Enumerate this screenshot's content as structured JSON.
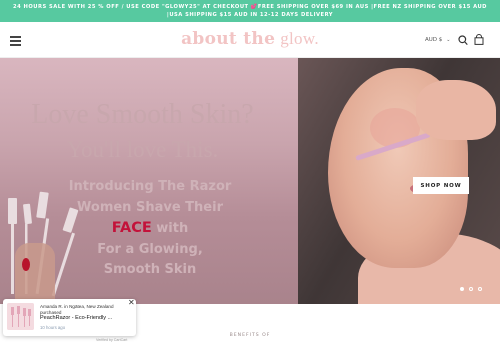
{
  "announcement": {
    "text": "24 HOURS SALE WITH 25 % OFF / USE CODE \"GLOWY25\" AT CHECKOUT 💕FREE SHIPPING OVER $69 IN AUS |FREE NZ SHIPPING OVER $15 AUD |USA SHIPPING $15 AUD IN 12-12 DAYS DELIVERY"
  },
  "header": {
    "logo_bold": "about the",
    "logo_light": "glow.",
    "currency": "AUD $",
    "icons": [
      "menu-icon",
      "search-icon",
      "cart-icon"
    ]
  },
  "hero": {
    "title": "Love Smooth Skin?",
    "subtitle": "You'll love This.",
    "intro_line1": "Introducing The Razor",
    "intro_line2": "Women Shave Their",
    "intro_face": "FACE",
    "intro_with": "with",
    "intro_line4": "For a Glowing,",
    "intro_line5": "Smooth Skin",
    "cta": "SHOP NOW",
    "slide_count": 3,
    "active_slide": 1
  },
  "popup": {
    "line1": "Amanda R. in Ngātea, New Zealand purchased",
    "product": "PeachRazor - Eco-Friendly ...",
    "time": "10 hours ago",
    "close": "✕",
    "verified": "Verified by CartCart"
  },
  "benefits": {
    "heading": "BENEFITS OF"
  },
  "colors": {
    "announcement_bg": "#57c9a0",
    "logo": "#f2c4c4",
    "face_accent": "#c3123a"
  }
}
